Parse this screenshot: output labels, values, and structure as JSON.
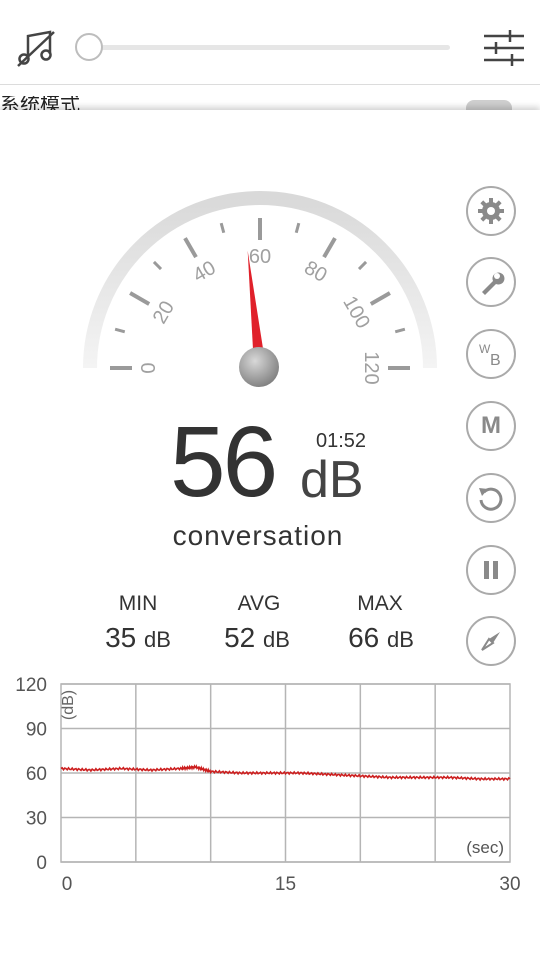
{
  "top_bar": {
    "music_icon": "music-note-slash-icon",
    "volume_level": 0.0,
    "settings_icon": "equalizer-sliders-icon",
    "hidden_row_label": "系统模式"
  },
  "gauge": {
    "min": 0,
    "max": 120,
    "tick_labels": [
      "0",
      "20",
      "40",
      "60",
      "80",
      "100",
      "120"
    ],
    "needle_value": 56
  },
  "reading": {
    "value": "56",
    "unit": "dB",
    "timer": "01:52",
    "description": "conversation"
  },
  "stats": [
    {
      "label": "MIN",
      "value": "35",
      "unit": "dB"
    },
    {
      "label": "AVG",
      "value": "52",
      "unit": "dB"
    },
    {
      "label": "MAX",
      "value": "66",
      "unit": "dB"
    }
  ],
  "side_buttons": [
    {
      "name": "settings-button",
      "icon": "gear-icon"
    },
    {
      "name": "calibrate-button",
      "icon": "wrench-icon"
    },
    {
      "name": "weighting-button",
      "icon": "wb-icon",
      "label_w": "W",
      "label_b": "B"
    },
    {
      "name": "memo-button",
      "icon": "m-icon",
      "label": "M"
    },
    {
      "name": "reset-button",
      "icon": "refresh-icon"
    },
    {
      "name": "pause-button",
      "icon": "pause-icon"
    },
    {
      "name": "compass-button",
      "icon": "compass-icon"
    }
  ],
  "chart_data": {
    "type": "line",
    "ylabel": "(dB)",
    "xlabel": "(sec)",
    "yticks": [
      "0",
      "30",
      "60",
      "90",
      "120"
    ],
    "xticks": [
      "0",
      "15",
      "30"
    ],
    "ylim": [
      0,
      120
    ],
    "xlim": [
      0,
      30
    ],
    "grid": true,
    "series": [
      {
        "color": "#cc1f1f",
        "x": [
          0,
          2,
          4,
          6,
          8,
          9,
          10,
          12,
          14,
          16,
          18,
          20,
          22,
          24,
          26,
          28,
          30
        ],
        "y": [
          63,
          62,
          63,
          62,
          63,
          64,
          61,
          60,
          60,
          60,
          59,
          58,
          57,
          57,
          57,
          56,
          56
        ]
      }
    ]
  }
}
